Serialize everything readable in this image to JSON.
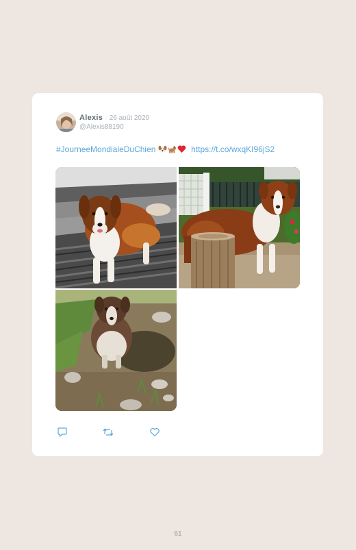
{
  "tweet": {
    "author_name": "Alexis",
    "separator": "·",
    "date": "26 août 2020",
    "handle": "@Alexis88190",
    "hashtag": "#JourneeMondialeDuChien",
    "emojis": [
      "dog-face-emoji",
      "dog-emoji",
      "red-heart-emoji"
    ],
    "link": "https://t.co/wxqKI96jS2",
    "photos": [
      {
        "description_icon": "dog-photo-1"
      },
      {
        "description_icon": "dog-photo-2"
      },
      {
        "description_icon": "dog-photo-3"
      }
    ]
  },
  "actions": [
    {
      "icon": "reply-icon"
    },
    {
      "icon": "retweet-icon"
    },
    {
      "icon": "like-icon"
    }
  ],
  "page": {
    "number": "61"
  },
  "colors": {
    "background": "#eee6e1",
    "card": "#ffffff",
    "link": "#5aa7dc",
    "muted": "#a8b0b6",
    "name": "#5f6b74"
  }
}
